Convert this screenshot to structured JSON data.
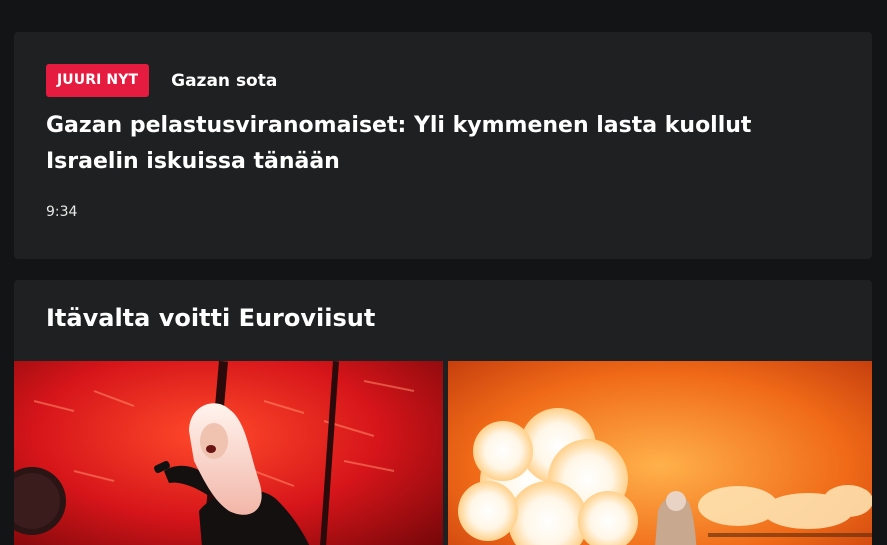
{
  "news_item": {
    "badge": "JUURI NYT",
    "category": "Gazan sota",
    "headline": "Gazan pelastusviranomaiset: Yli kymmenen lasta kuollut Israelin iskuissa tänään",
    "time": "9:34"
  },
  "feature": {
    "title": "Itävalta voitti Euroviisut"
  },
  "colors": {
    "badge_bg": "#e51b3f",
    "card_bg": "#1f2021",
    "page_bg": "#131415"
  }
}
